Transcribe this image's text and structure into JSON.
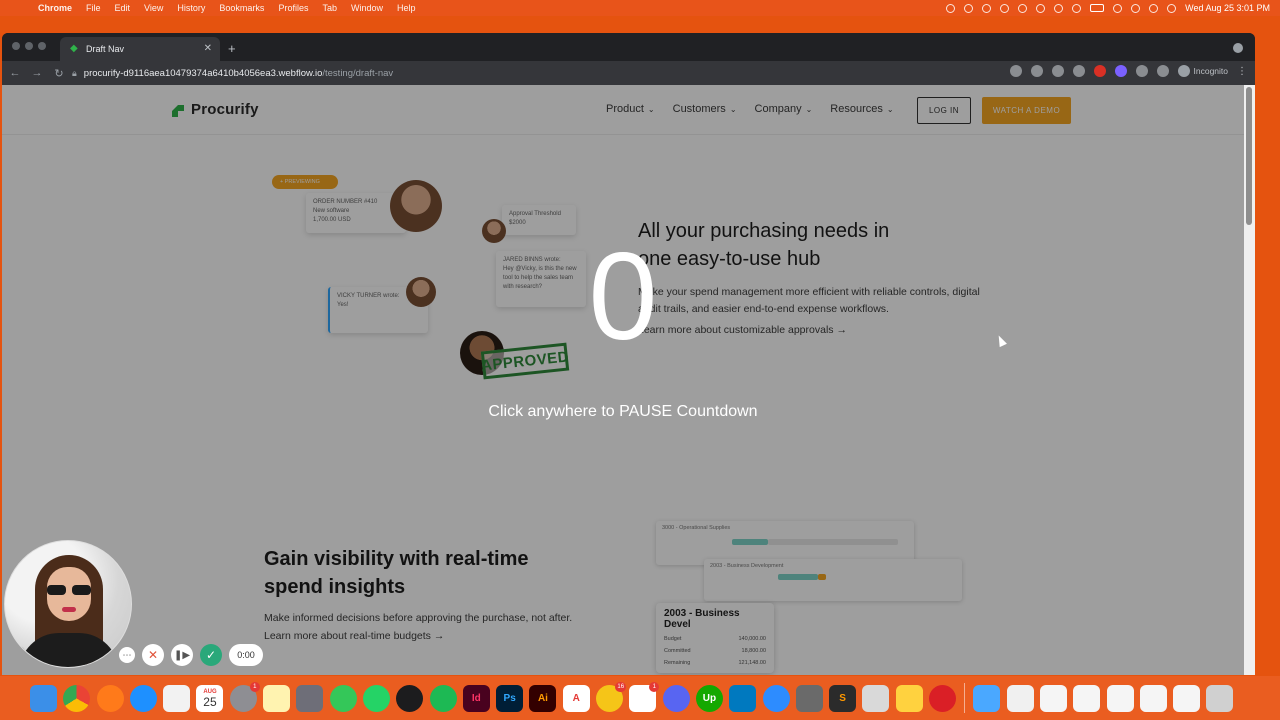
{
  "menubar": {
    "app": "Chrome",
    "items": [
      "File",
      "Edit",
      "View",
      "History",
      "Bookmarks",
      "Profiles",
      "Tab",
      "Window",
      "Help"
    ],
    "clock": "Wed Aug 25  3:01 PM"
  },
  "browser": {
    "tab_title": "Draft Nav",
    "url_host": "procurify-d9116aea10479374a6410b4056ea3.webflow.io",
    "url_path": "/testing/draft-nav",
    "incognito_label": "Incognito"
  },
  "site": {
    "logo": "Procurify",
    "nav": [
      "Product",
      "Customers",
      "Company",
      "Resources"
    ],
    "login": "LOG IN",
    "demo": "WATCH A DEMO",
    "hero": {
      "title_line1": "All your purchasing needs in",
      "title_line2": "one easy-to-use hub",
      "body": "Make your spend management more efficient with reliable controls, digital audit trails, and easier end-to-end expense workflows.",
      "link": "Learn more about customizable approvals →"
    },
    "illustration": {
      "tag": "+ PREVIEWING",
      "order_label": "ORDER NUMBER #410",
      "order_item": "New software",
      "order_amount": "1,700.00 USD",
      "approval_label": "Approval Threshold",
      "approval_amount": "$2000",
      "comment1_author": "JARED BINNS wrote:",
      "comment1_text": "Hey @Vicky, is this the new tool to help the sales team with research?",
      "comment2_author": "VICKY TURNER wrote:",
      "comment2_text": "Yes!",
      "stamp": "APPROVED"
    },
    "section2": {
      "title_line1": "Gain visibility with real-time",
      "title_line2": "spend insights",
      "body": "Make informed decisions before approving the purchase, not after.",
      "link": "Learn more about real-time budgets →"
    },
    "dashboard": {
      "panel1_title": "3000 - Operational Supplies",
      "panel2_title": "2003 - Business Development",
      "big_title": "2003 - Business Devel",
      "rows": [
        {
          "label": "Budget",
          "value": "140,000.00"
        },
        {
          "label": "Committed",
          "value": "18,800.00"
        },
        {
          "label": "Remaining",
          "value": "121,148.00"
        }
      ]
    }
  },
  "overlay": {
    "countdown": "0",
    "instruction": "Click anywhere to PAUSE Countdown"
  },
  "recorder": {
    "timer": "0:00"
  },
  "dock": {
    "calendar_month": "AUG",
    "calendar_day": "25",
    "badges": {
      "settings": "1",
      "notes": "16",
      "slack": "1"
    }
  }
}
